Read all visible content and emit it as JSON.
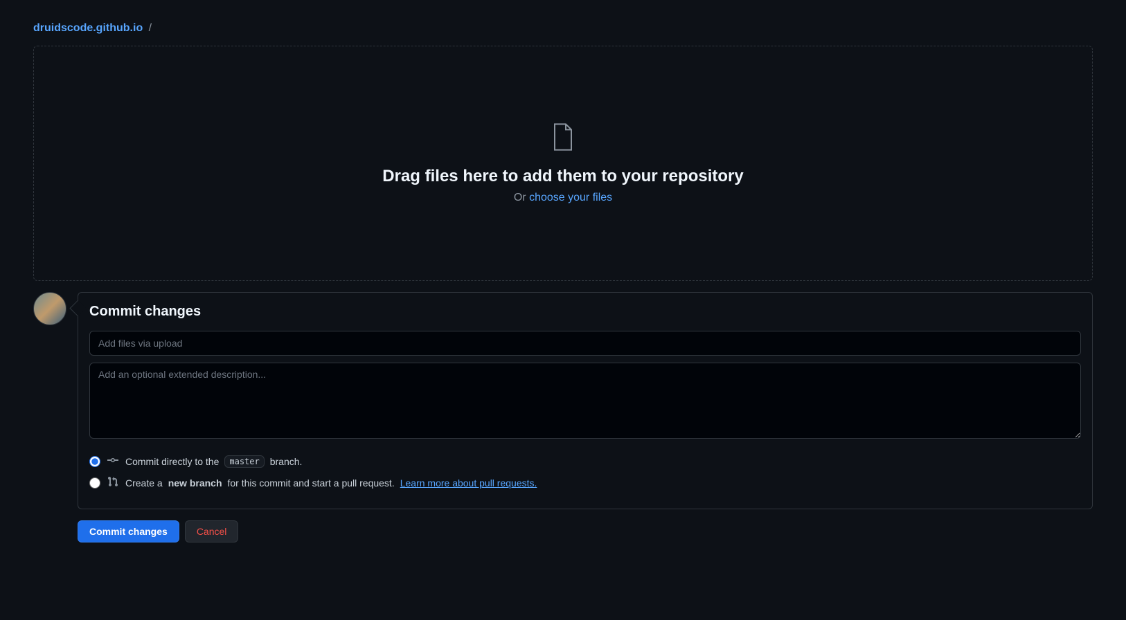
{
  "breadcrumb": {
    "repo": "druidscode.github.io",
    "separator": "/"
  },
  "dropzone": {
    "title": "Drag files here to add them to your repository",
    "or_text": "Or ",
    "choose_link": "choose your files"
  },
  "commit": {
    "heading": "Commit changes",
    "summary_placeholder": "Add files via upload",
    "description_placeholder": "Add an optional extended description...",
    "option_direct": {
      "pre": "Commit directly to the ",
      "branch": "master",
      "post": " branch."
    },
    "option_newbranch": {
      "pre": "Create a ",
      "bold": "new branch",
      "post": " for this commit and start a pull request. ",
      "learn_link": "Learn more about pull requests."
    }
  },
  "actions": {
    "commit": "Commit changes",
    "cancel": "Cancel"
  }
}
